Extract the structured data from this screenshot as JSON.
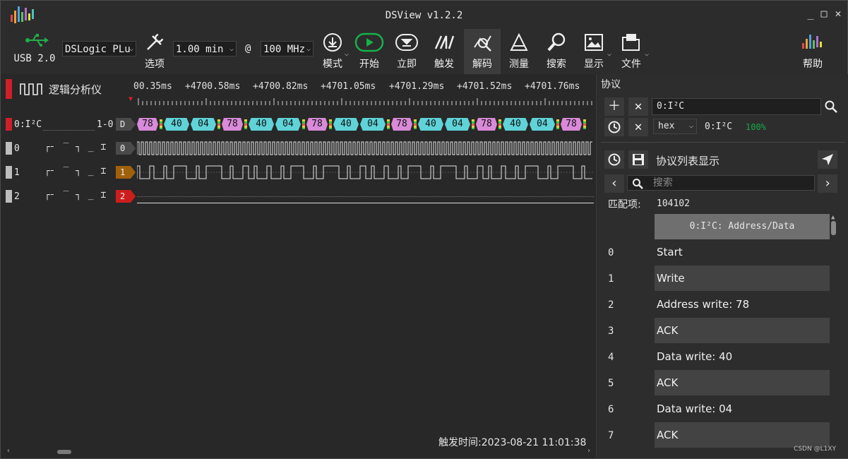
{
  "window": {
    "title": "DSView v1.2.2",
    "min": "_",
    "max": "□",
    "close": "✕"
  },
  "toolbar": {
    "usb_label": "USB 2.0",
    "device": "DSLogic PLu",
    "options_label": "选项",
    "duration": "1.00 min",
    "at": "@",
    "rate": "100 MHz",
    "mode_label": "模式",
    "start_label": "开始",
    "instant_label": "立即",
    "trigger_label": "触发",
    "decode_label": "解码",
    "measure_label": "测量",
    "search_label": "搜索",
    "display_label": "显示",
    "file_label": "文件",
    "help_label": "帮助"
  },
  "signal": {
    "analyzer_label": "逻辑分析仪",
    "ruler": [
      "00.35ms",
      "+4700.58ms",
      "+4700.82ms",
      "+4701.05ms",
      "+4701.29ms",
      "+4701.52ms",
      "+4701.76ms"
    ],
    "decoder_row": {
      "name": "0:I²C",
      "range": "1-0",
      "tag": "D",
      "cells": [
        "78",
        "40",
        "04",
        "78",
        "40",
        "04",
        "78",
        "40",
        "04",
        "78",
        "40",
        "04",
        "78",
        "40",
        "04",
        "78"
      ]
    },
    "channels": [
      {
        "name": "0",
        "tag": "0",
        "color": "#4a4a4a"
      },
      {
        "name": "1",
        "tag": "1",
        "color": "#a0600c"
      },
      {
        "name": "2",
        "tag": "2",
        "color": "#cc1d1d"
      }
    ],
    "trigger_time": "触发时间:2023-08-21 11:01:38"
  },
  "colors": {
    "pink": "#d98ad9",
    "cyan": "#5fd3d8",
    "red": "#cf2027",
    "green": "#20c040",
    "accent_green": "#17a84a"
  },
  "protocol": {
    "header": "协议",
    "decoder_input": "0:I²C",
    "format": "hex",
    "decoder_name": "0:I²C",
    "progress": "100%",
    "list_title": "协议列表显示",
    "search_placeholder": "搜索",
    "match_label": "匹配项:",
    "match_count": "104102",
    "column_header": "0:I²C: Address/Data",
    "rows": [
      {
        "idx": "0",
        "text": "Start"
      },
      {
        "idx": "1",
        "text": "Write"
      },
      {
        "idx": "2",
        "text": "Address write: 78"
      },
      {
        "idx": "3",
        "text": "ACK"
      },
      {
        "idx": "4",
        "text": "Data write: 40"
      },
      {
        "idx": "5",
        "text": "ACK"
      },
      {
        "idx": "6",
        "text": "Data write: 04"
      },
      {
        "idx": "7",
        "text": "ACK"
      }
    ]
  },
  "watermark": "CSDN @L1XY"
}
